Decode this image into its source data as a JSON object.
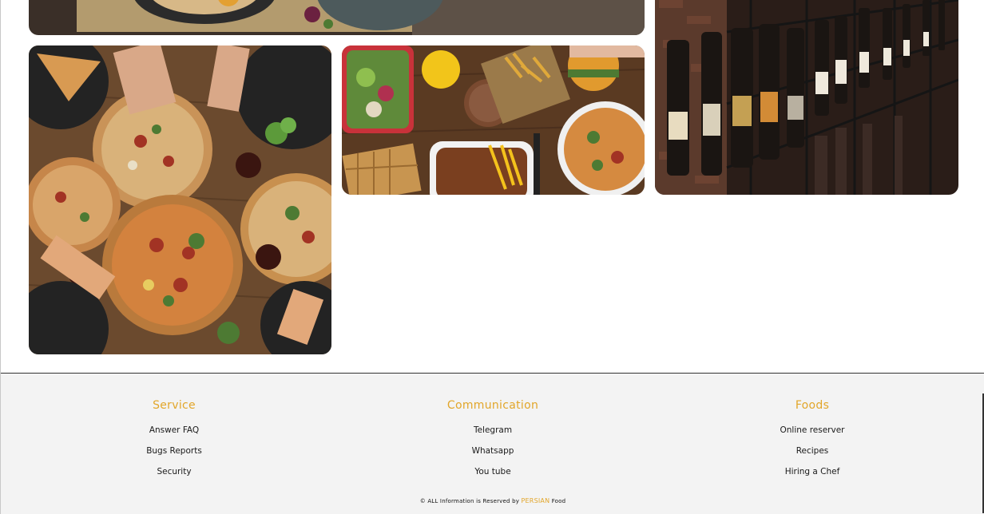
{
  "gallery": {
    "images": [
      {
        "subject": "stew-pot",
        "alt": ""
      },
      {
        "subject": "wine-shelves",
        "alt": ""
      },
      {
        "subject": "pizza-table",
        "alt": ""
      },
      {
        "subject": "mixed-dishes",
        "alt": ""
      }
    ]
  },
  "footer": {
    "columns": [
      {
        "title": "Service",
        "links": [
          "Answer FAQ",
          "Bugs Reports",
          "Security"
        ]
      },
      {
        "title": "Communication",
        "links": [
          "Telegram",
          "Whatsapp",
          "You tube"
        ]
      },
      {
        "title": "Foods",
        "links": [
          "Online reserver",
          "Recipes",
          "Hiring a Chef"
        ]
      }
    ],
    "copyright": {
      "prefix": "© ALL Information is Reserved by",
      "brand": "PERSIAN",
      "suffix": "Food"
    }
  },
  "colors": {
    "accent": "#e2a62a",
    "footer_bg": "#f3f3f3"
  }
}
